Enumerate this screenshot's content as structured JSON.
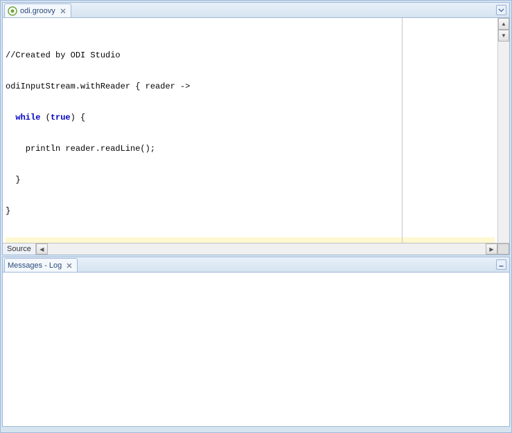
{
  "editor": {
    "tab": {
      "label": "odi.groovy"
    },
    "code": {
      "line1_comment": "//Created by ODI Studio",
      "line2_pre": "odiInputStream.withReader { reader ->",
      "line3_indent": "  ",
      "line3_kw1": "while",
      "line3_mid": " (",
      "line3_kw2": "true",
      "line3_post": ") {",
      "line4": "    println reader.readLine();",
      "line5": "  }",
      "line6": "}"
    },
    "bottom_tab": "Source"
  },
  "log": {
    "tab": {
      "label": "Messages - Log"
    }
  }
}
